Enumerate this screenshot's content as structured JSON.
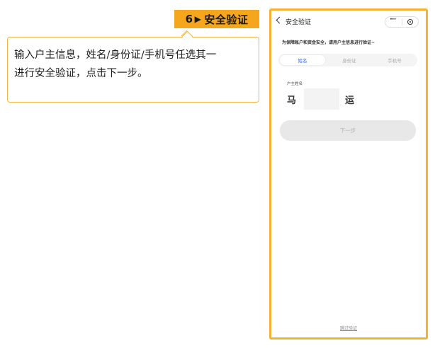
{
  "step": {
    "number": "6",
    "arrow": "▶",
    "title": "安全验证"
  },
  "callout": {
    "line1": "输入户主信息，姓名/身份证/手机号任选其一",
    "line2": "进行安全验证，点击下一步。"
  },
  "phone": {
    "nav": {
      "back_icon": "chevron-left-icon",
      "title": "安全验证",
      "more_icon": "···",
      "target_icon": "target-icon"
    },
    "notice": "为保障账户和资金安全，请用户主信息进行验证~",
    "tabs": [
      {
        "label": "姓名",
        "active": true
      },
      {
        "label": "身份证",
        "active": false
      },
      {
        "label": "手机号",
        "active": false
      }
    ],
    "field_label": "户主姓名",
    "name_first": "马",
    "name_last": "运",
    "next_button": "下一步",
    "skip_link": "跳过验证"
  },
  "colors": {
    "accent": "#f5a61c",
    "frame": "#f5b22f",
    "tab_active": "#3a6fd8"
  }
}
